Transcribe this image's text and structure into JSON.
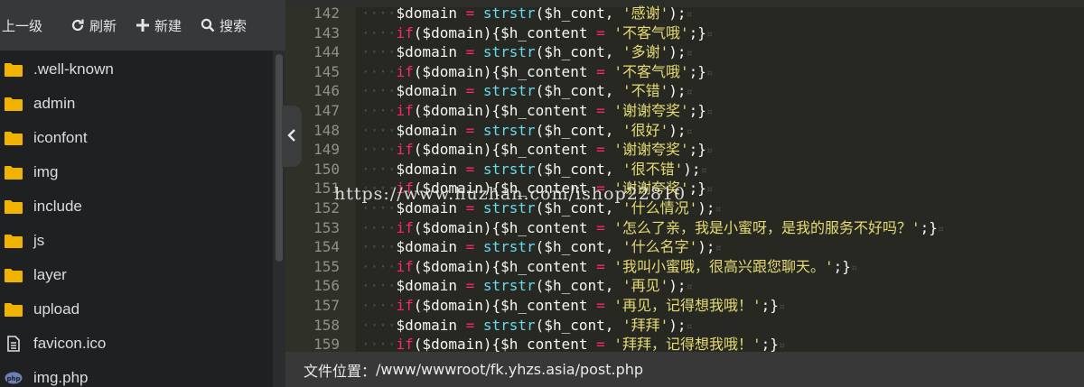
{
  "toolbar": {
    "up_label": "上一级",
    "refresh_label": "刷新",
    "new_label": "新建",
    "search_label": "搜索"
  },
  "files": [
    {
      "name": ".well-known",
      "icon": "folder-icon"
    },
    {
      "name": "admin",
      "icon": "folder-icon"
    },
    {
      "name": "iconfont",
      "icon": "folder-icon"
    },
    {
      "name": "img",
      "icon": "folder-icon"
    },
    {
      "name": "include",
      "icon": "folder-icon"
    },
    {
      "name": "js",
      "icon": "folder-icon"
    },
    {
      "name": "layer",
      "icon": "folder-icon"
    },
    {
      "name": "upload",
      "icon": "folder-icon"
    },
    {
      "name": "favicon.ico",
      "icon": "file-icon"
    },
    {
      "name": "img.php",
      "icon": "php-file-icon"
    }
  ],
  "colors": {
    "folder": "#f0b400",
    "editor_bg": "#272822",
    "keyword": "#f92672",
    "function": "#66d9ef",
    "string": "#e6db74"
  },
  "code_lines": [
    {
      "num": "142",
      "kind": "assign",
      "str": "'感谢'"
    },
    {
      "num": "143",
      "kind": "if",
      "str": "'不客气哦'"
    },
    {
      "num": "144",
      "kind": "assign",
      "str": "'多谢'"
    },
    {
      "num": "145",
      "kind": "if",
      "str": "'不客气哦'"
    },
    {
      "num": "146",
      "kind": "assign",
      "str": "'不错'"
    },
    {
      "num": "147",
      "kind": "if",
      "str": "'谢谢夸奖'"
    },
    {
      "num": "148",
      "kind": "assign",
      "str": "'很好'"
    },
    {
      "num": "149",
      "kind": "if",
      "str": "'谢谢夸奖'"
    },
    {
      "num": "150",
      "kind": "assign",
      "str": "'很不错'"
    },
    {
      "num": "151",
      "kind": "if",
      "str": "'谢谢夸奖'"
    },
    {
      "num": "152",
      "kind": "assign",
      "str": "'什么情况'"
    },
    {
      "num": "153",
      "kind": "if",
      "str": "'怎么了亲，我是小蜜呀，是我的服务不好吗？'"
    },
    {
      "num": "154",
      "kind": "assign",
      "str": "'什么名字'"
    },
    {
      "num": "155",
      "kind": "if",
      "str": "'我叫小蜜哦，很高兴跟您聊天。'"
    },
    {
      "num": "156",
      "kind": "assign",
      "str": "'再见'"
    },
    {
      "num": "157",
      "kind": "if",
      "str": "'再见，记得想我哦！'"
    },
    {
      "num": "158",
      "kind": "assign",
      "str": "'拜拜'"
    },
    {
      "num": "159",
      "kind": "if",
      "str": "'拜拜，记得想我哦！'"
    }
  ],
  "code_tokens": {
    "indent": "····",
    "assign_var": "$domain",
    "assign_op": " = ",
    "assign_fn": "strstr",
    "assign_args": "($h_cont, ",
    "assign_end": ");",
    "if_kw": "if",
    "if_cond": "($domain){",
    "if_var": "$h_content",
    "if_op": " = ",
    "if_end": ";}",
    "eol_mark": "¤"
  },
  "watermark": "https://www.huzhan.com/ishop22810",
  "status": {
    "label": "文件位置：",
    "path": "/www/wwwroot/fk.yhzs.asia/post.php"
  }
}
